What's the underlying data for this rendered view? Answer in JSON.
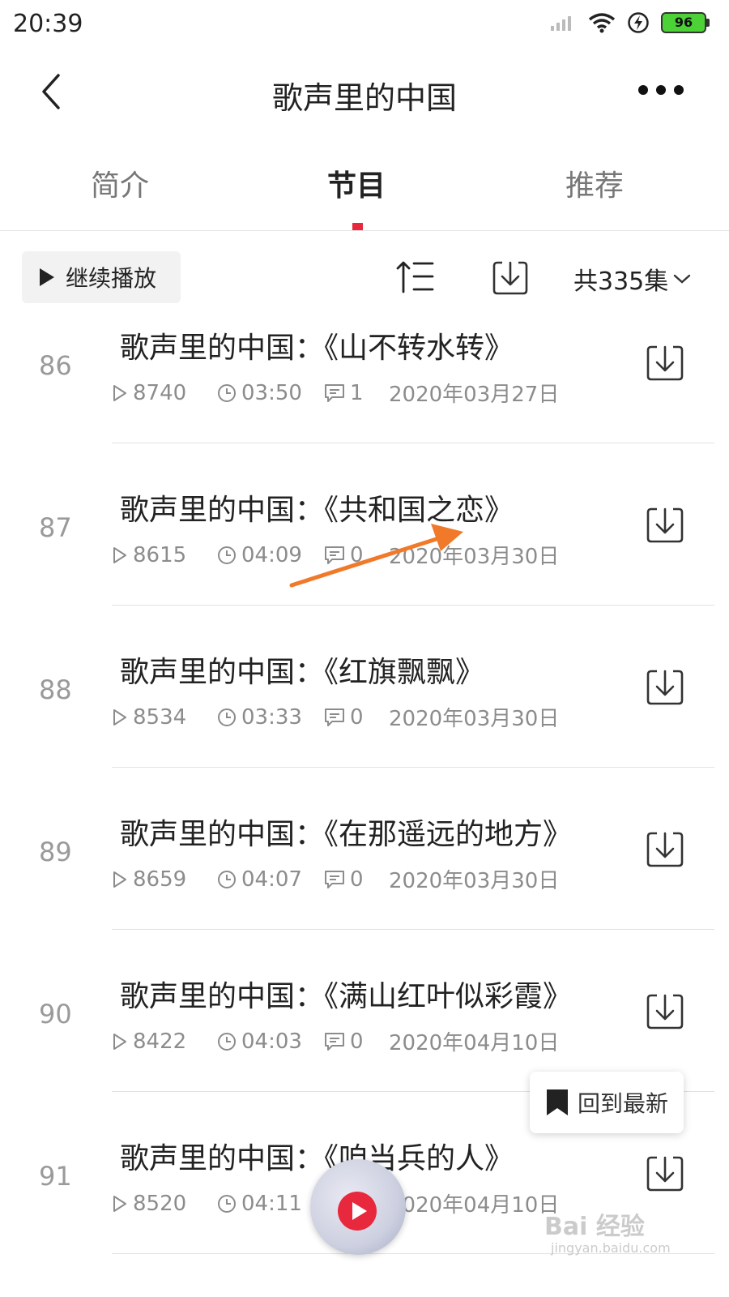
{
  "status_bar": {
    "time": "20:39",
    "battery": "96"
  },
  "header": {
    "title": "歌声里的中国"
  },
  "tabs": [
    {
      "label": "简介"
    },
    {
      "label": "节目"
    },
    {
      "label": "推荐"
    }
  ],
  "toolbar": {
    "continue_label": "继续播放",
    "total_label": "共335集"
  },
  "episodes": [
    {
      "num": "86",
      "title": "歌声里的中国：《山不转水转》",
      "plays": "8740",
      "duration": "03:50",
      "comments": "1",
      "date": "2020年03月27日"
    },
    {
      "num": "87",
      "title": "歌声里的中国：《共和国之恋》",
      "plays": "8615",
      "duration": "04:09",
      "comments": "0",
      "date": "2020年03月30日"
    },
    {
      "num": "88",
      "title": "歌声里的中国：《红旗飘飘》",
      "plays": "8534",
      "duration": "03:33",
      "comments": "0",
      "date": "2020年03月30日"
    },
    {
      "num": "89",
      "title": "歌声里的中国：《在那遥远的地方》",
      "plays": "8659",
      "duration": "04:07",
      "comments": "0",
      "date": "2020年03月30日"
    },
    {
      "num": "90",
      "title": "歌声里的中国：《满山红叶似彩霞》",
      "plays": "8422",
      "duration": "04:03",
      "comments": "0",
      "date": "2020年04月10日"
    },
    {
      "num": "91",
      "title": "歌声里的中国：《咱当兵的人》",
      "plays": "8520",
      "duration": "04:11",
      "comments": "",
      "date": "2020年04月10日"
    }
  ],
  "back_to_latest": "回到最新",
  "watermark": {
    "text": "Bai 经验",
    "sub": "jingyan.baidu.com"
  },
  "colors": {
    "accent": "#e8283c",
    "annotation_arrow": "#f07a2a"
  }
}
